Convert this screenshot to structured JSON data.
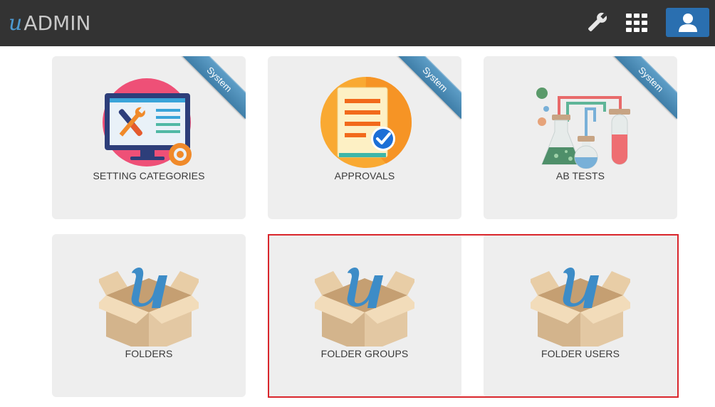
{
  "header": {
    "logo_u": "u",
    "logo_text": "ADMIN",
    "icons": [
      "wrench-icon",
      "grid-icon",
      "user-icon"
    ]
  },
  "tiles": [
    {
      "label": "SETTING CATEGORIES",
      "badge": "System",
      "icon": "monitor-tools-icon"
    },
    {
      "label": "APPROVALS",
      "badge": "System",
      "icon": "approval-document-icon"
    },
    {
      "label": "AB TESTS",
      "badge": "System",
      "icon": "lab-flasks-icon"
    },
    {
      "label": "FOLDERS",
      "icon": "u-box-icon"
    },
    {
      "label": "FOLDER GROUPS",
      "icon": "u-box-icon"
    },
    {
      "label": "FOLDER USERS",
      "icon": "u-box-icon"
    }
  ],
  "colors": {
    "topbar": "#333333",
    "accent_blue": "#2a6fb0",
    "tile_bg": "#eeeeee",
    "ribbon": "#4a8ab5",
    "highlight": "#d9262c"
  }
}
